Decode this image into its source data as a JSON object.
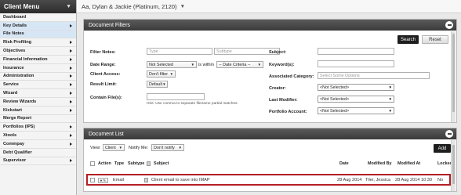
{
  "sidebar": {
    "title": "Client Menu",
    "items": [
      {
        "label": "Dashboard",
        "arrow": false,
        "active": false
      },
      {
        "label": "Key Details",
        "arrow": true,
        "active": true
      },
      {
        "label": "File Notes",
        "arrow": false,
        "active": true
      },
      {
        "label": "Risk Profiling",
        "arrow": true,
        "active": false
      },
      {
        "label": "Objectives",
        "arrow": true,
        "active": false
      },
      {
        "label": "Financial Information",
        "arrow": true,
        "active": false
      },
      {
        "label": "Insurance",
        "arrow": true,
        "active": false
      },
      {
        "label": "Administration",
        "arrow": true,
        "active": false
      },
      {
        "label": "Service",
        "arrow": true,
        "active": false
      },
      {
        "label": "Wizard",
        "arrow": true,
        "active": false
      },
      {
        "label": "Review Wizards",
        "arrow": true,
        "active": false
      },
      {
        "label": "Kickstart",
        "arrow": true,
        "active": false
      },
      {
        "label": "Merge Report",
        "arrow": false,
        "active": false
      },
      {
        "label": "Portfolios (IPS)",
        "arrow": true,
        "active": false
      },
      {
        "label": "Xtools",
        "arrow": true,
        "active": false
      },
      {
        "label": "Commpay",
        "arrow": true,
        "active": false
      },
      {
        "label": "Debt Qualifier",
        "arrow": false,
        "active": false
      },
      {
        "label": "Supervisor",
        "arrow": true,
        "active": false
      }
    ]
  },
  "topbar": {
    "client_name": "Aa, Dylan & Jackie (Platinum, 2120)"
  },
  "filters": {
    "title": "Document Filters",
    "search_label": "Search",
    "reset_label": "Reset",
    "filter_notes_label": "Filter Notes:",
    "type_placeholder": "Type",
    "subtype_placeholder": "Subtype",
    "date_range_label": "Date Range:",
    "date_range_value": "Not Selected",
    "is_within_text": "is within",
    "date_criteria_value": "-- Date Criteria --",
    "client_access_label": "Client Access:",
    "client_access_value": "Don't filter",
    "result_limit_label": "Result Limit:",
    "result_limit_value": "Default",
    "contain_files_label": "Contain File(s):",
    "contain_files_note": "Hint: Use comma to separate filename partial matches.",
    "subject_label": "Subject:",
    "keywords_label": "Keyword(s):",
    "associated_category_label": "Associated Category:",
    "associated_category_placeholder": "Select Some Options",
    "creator_label": "Creator:",
    "creator_value": "<Not Selected>",
    "last_modifier_label": "Last Modifier:",
    "last_modifier_value": "<Not Selected>",
    "portfolio_account_label": "Portfolio Account:",
    "portfolio_account_value": "<Not Selected>"
  },
  "doclist": {
    "title": "Document List",
    "view_label": "View:",
    "view_value": "Client",
    "notify_label": "Notify Me:",
    "notify_value": "Don't notify",
    "add_label": "Add",
    "columns": {
      "action": "Action",
      "type": "Type",
      "subtype": "Subtype",
      "subject": "Subject",
      "date": "Date",
      "modified_by": "Modified By",
      "modified_at": "Modified At",
      "locked": "Locked"
    },
    "rows": [
      {
        "type": "Email",
        "subtype": "",
        "subject": "Client email to save into IMAP",
        "date": "28 Aug 2014",
        "modified_by": "Tiler, Jessica",
        "modified_at": "28 Aug 2014 10:30",
        "locked": "No"
      }
    ]
  }
}
